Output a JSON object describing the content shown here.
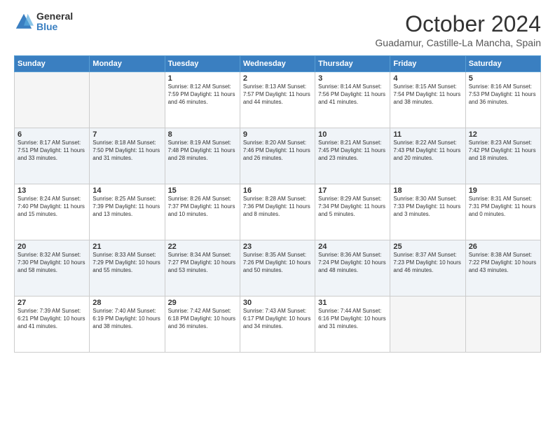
{
  "header": {
    "logo_general": "General",
    "logo_blue": "Blue",
    "month_title": "October 2024",
    "location": "Guadamur, Castille-La Mancha, Spain"
  },
  "days_of_week": [
    "Sunday",
    "Monday",
    "Tuesday",
    "Wednesday",
    "Thursday",
    "Friday",
    "Saturday"
  ],
  "weeks": [
    [
      {
        "day": "",
        "info": ""
      },
      {
        "day": "",
        "info": ""
      },
      {
        "day": "1",
        "info": "Sunrise: 8:12 AM\nSunset: 7:59 PM\nDaylight: 11 hours and 46 minutes."
      },
      {
        "day": "2",
        "info": "Sunrise: 8:13 AM\nSunset: 7:57 PM\nDaylight: 11 hours and 44 minutes."
      },
      {
        "day": "3",
        "info": "Sunrise: 8:14 AM\nSunset: 7:56 PM\nDaylight: 11 hours and 41 minutes."
      },
      {
        "day": "4",
        "info": "Sunrise: 8:15 AM\nSunset: 7:54 PM\nDaylight: 11 hours and 38 minutes."
      },
      {
        "day": "5",
        "info": "Sunrise: 8:16 AM\nSunset: 7:53 PM\nDaylight: 11 hours and 36 minutes."
      }
    ],
    [
      {
        "day": "6",
        "info": "Sunrise: 8:17 AM\nSunset: 7:51 PM\nDaylight: 11 hours and 33 minutes."
      },
      {
        "day": "7",
        "info": "Sunrise: 8:18 AM\nSunset: 7:50 PM\nDaylight: 11 hours and 31 minutes."
      },
      {
        "day": "8",
        "info": "Sunrise: 8:19 AM\nSunset: 7:48 PM\nDaylight: 11 hours and 28 minutes."
      },
      {
        "day": "9",
        "info": "Sunrise: 8:20 AM\nSunset: 7:46 PM\nDaylight: 11 hours and 26 minutes."
      },
      {
        "day": "10",
        "info": "Sunrise: 8:21 AM\nSunset: 7:45 PM\nDaylight: 11 hours and 23 minutes."
      },
      {
        "day": "11",
        "info": "Sunrise: 8:22 AM\nSunset: 7:43 PM\nDaylight: 11 hours and 20 minutes."
      },
      {
        "day": "12",
        "info": "Sunrise: 8:23 AM\nSunset: 7:42 PM\nDaylight: 11 hours and 18 minutes."
      }
    ],
    [
      {
        "day": "13",
        "info": "Sunrise: 8:24 AM\nSunset: 7:40 PM\nDaylight: 11 hours and 15 minutes."
      },
      {
        "day": "14",
        "info": "Sunrise: 8:25 AM\nSunset: 7:39 PM\nDaylight: 11 hours and 13 minutes."
      },
      {
        "day": "15",
        "info": "Sunrise: 8:26 AM\nSunset: 7:37 PM\nDaylight: 11 hours and 10 minutes."
      },
      {
        "day": "16",
        "info": "Sunrise: 8:28 AM\nSunset: 7:36 PM\nDaylight: 11 hours and 8 minutes."
      },
      {
        "day": "17",
        "info": "Sunrise: 8:29 AM\nSunset: 7:34 PM\nDaylight: 11 hours and 5 minutes."
      },
      {
        "day": "18",
        "info": "Sunrise: 8:30 AM\nSunset: 7:33 PM\nDaylight: 11 hours and 3 minutes."
      },
      {
        "day": "19",
        "info": "Sunrise: 8:31 AM\nSunset: 7:31 PM\nDaylight: 11 hours and 0 minutes."
      }
    ],
    [
      {
        "day": "20",
        "info": "Sunrise: 8:32 AM\nSunset: 7:30 PM\nDaylight: 10 hours and 58 minutes."
      },
      {
        "day": "21",
        "info": "Sunrise: 8:33 AM\nSunset: 7:29 PM\nDaylight: 10 hours and 55 minutes."
      },
      {
        "day": "22",
        "info": "Sunrise: 8:34 AM\nSunset: 7:27 PM\nDaylight: 10 hours and 53 minutes."
      },
      {
        "day": "23",
        "info": "Sunrise: 8:35 AM\nSunset: 7:26 PM\nDaylight: 10 hours and 50 minutes."
      },
      {
        "day": "24",
        "info": "Sunrise: 8:36 AM\nSunset: 7:24 PM\nDaylight: 10 hours and 48 minutes."
      },
      {
        "day": "25",
        "info": "Sunrise: 8:37 AM\nSunset: 7:23 PM\nDaylight: 10 hours and 46 minutes."
      },
      {
        "day": "26",
        "info": "Sunrise: 8:38 AM\nSunset: 7:22 PM\nDaylight: 10 hours and 43 minutes."
      }
    ],
    [
      {
        "day": "27",
        "info": "Sunrise: 7:39 AM\nSunset: 6:21 PM\nDaylight: 10 hours and 41 minutes."
      },
      {
        "day": "28",
        "info": "Sunrise: 7:40 AM\nSunset: 6:19 PM\nDaylight: 10 hours and 38 minutes."
      },
      {
        "day": "29",
        "info": "Sunrise: 7:42 AM\nSunset: 6:18 PM\nDaylight: 10 hours and 36 minutes."
      },
      {
        "day": "30",
        "info": "Sunrise: 7:43 AM\nSunset: 6:17 PM\nDaylight: 10 hours and 34 minutes."
      },
      {
        "day": "31",
        "info": "Sunrise: 7:44 AM\nSunset: 6:16 PM\nDaylight: 10 hours and 31 minutes."
      },
      {
        "day": "",
        "info": ""
      },
      {
        "day": "",
        "info": ""
      }
    ]
  ]
}
